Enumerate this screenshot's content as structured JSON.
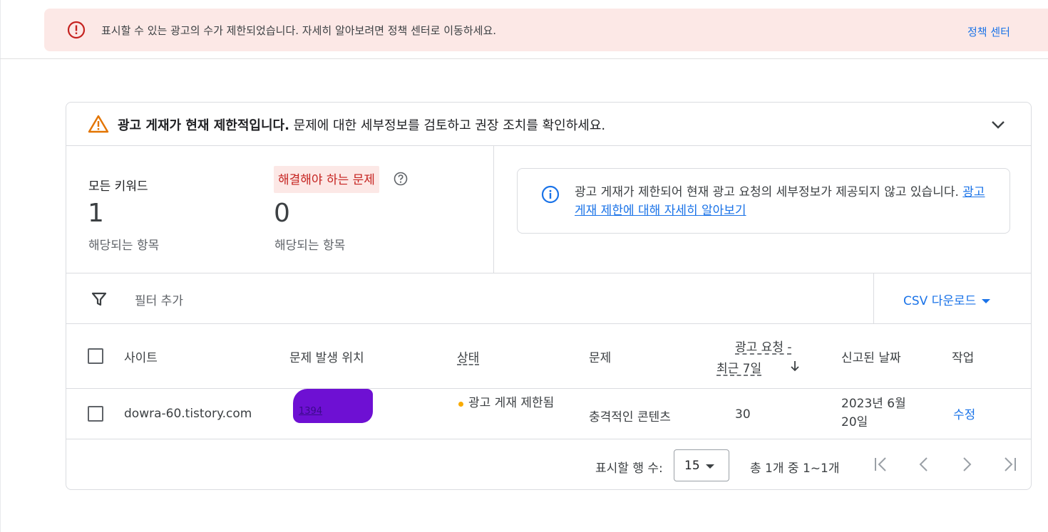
{
  "banner": {
    "message": "표시할 수 있는 광고의 수가 제한되었습니다. 자세히 알아보려면 정책 센터로 이동하세요.",
    "link_label": "정책 센터",
    "icon": "error-circle-icon",
    "color": "#fce8e6"
  },
  "card": {
    "header_bold": "광고 게재가 현재 제한적입니다.",
    "header_rest": " 문제에 대한 세부정보를 검토하고 권장 조치를 확인하세요.",
    "warning_icon": "warning-triangle-icon",
    "expand_icon": "chevron-down-icon"
  },
  "stats": {
    "all_keywords_label": "모든 키워드",
    "all_keywords_count": "1",
    "all_keywords_sub": "해당되는 항목",
    "issues_label": "해결해야 하는 문제",
    "issues_count": "0",
    "issues_sub": "해당되는 항목"
  },
  "info": {
    "text_before": "광고 게재가 제한되어 현재 광고 요청의 세부정보가 제공되지 않고 있습니다. ",
    "link_text": "광고 게재 제한에 대해 자세히 알아보기",
    "icon": "info-circle-icon"
  },
  "toolbar": {
    "filter_label": "필터 추가",
    "csv_label": "CSV 다운로드"
  },
  "table": {
    "headers": {
      "site": "사이트",
      "location": "문제 발생 위치",
      "status": "상태",
      "issue": "문제",
      "requests_line1": "광고 요청 -",
      "requests_line2": "최근 7일",
      "reported_date": "신고된 날짜",
      "action": "작업"
    },
    "sort_direction": "descending",
    "rows": [
      {
        "site": "dowra-60.tistory.com",
        "location": "1394",
        "status": "광고 게재 제한됨",
        "issue": "충격적인 콘텐츠",
        "requests": "30",
        "reported_date": "2023년 6월 20일",
        "action": "수정"
      }
    ]
  },
  "pagination": {
    "rows_label": "표시할 행 수:",
    "rows_value": "15",
    "range_text": "총 1개 중 1~1개"
  },
  "colors": {
    "accent": "#1a73e8",
    "error": "#c5221f",
    "warning": "#e37400",
    "status_dot": "#f9ab00"
  }
}
